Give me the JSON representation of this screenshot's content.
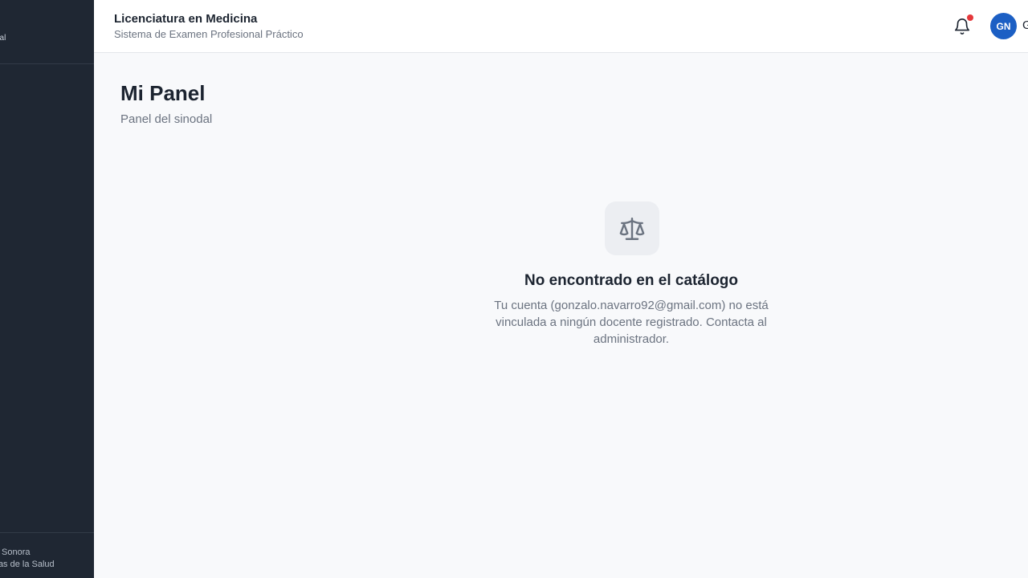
{
  "sidebar": {
    "brand_fragment": "nal",
    "footer_line1": "Sonora",
    "footer_line2": "cias de la Salud"
  },
  "header": {
    "title": "Licenciatura en Medicina",
    "subtitle": "Sistema de Examen Profesional Práctico",
    "avatar_initials": "GN",
    "user_name_fragment": "G",
    "icons": {
      "notifications": "bell-icon"
    },
    "colors": {
      "avatar": "#1c5fc4",
      "notification_dot": "#e5383b"
    }
  },
  "main": {
    "title": "Mi Panel",
    "subtitle": "Panel del sinodal",
    "empty_state": {
      "icon": "scale-icon",
      "title": "No encontrado en el catálogo",
      "message": "Tu cuenta (gonzalo.navarro92@gmail.com) no está vinculada a ningún docente registrado. Contacta al administrador."
    }
  }
}
